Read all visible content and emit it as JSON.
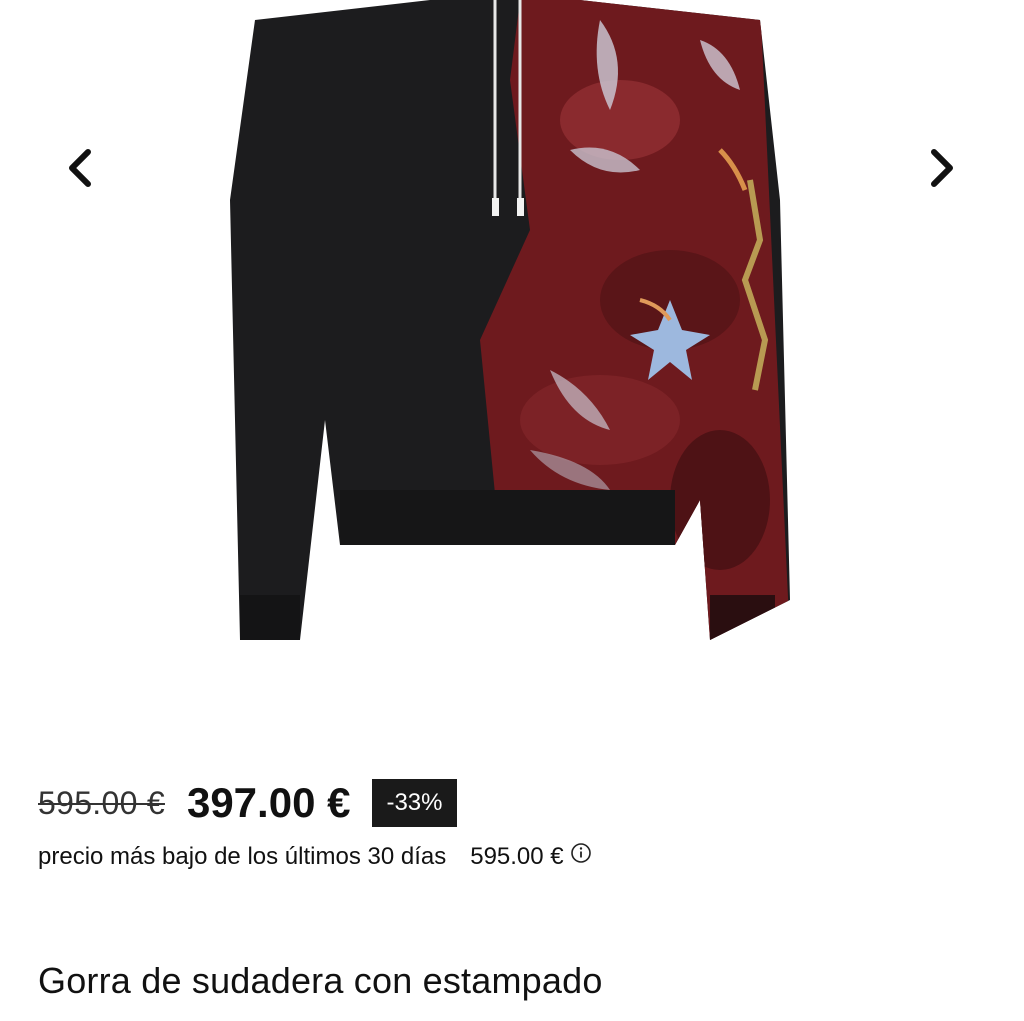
{
  "gallery": {
    "prev_icon": "chevron-left-icon",
    "next_icon": "chevron-right-icon",
    "image": "hoodie-photo"
  },
  "price": {
    "original": "595.00 €",
    "current": "397.00 €",
    "discount": "-33%"
  },
  "lowest_price": {
    "label": "precio más bajo de los últimos 30 días",
    "value": "595.00 €",
    "icon": "info-icon"
  },
  "product": {
    "title": "Gorra de sudadera con estampado"
  },
  "colors": {
    "body": "#1c1c1e",
    "print_red": "#6e1a1e",
    "badge_bg": "#1a1a1a"
  }
}
